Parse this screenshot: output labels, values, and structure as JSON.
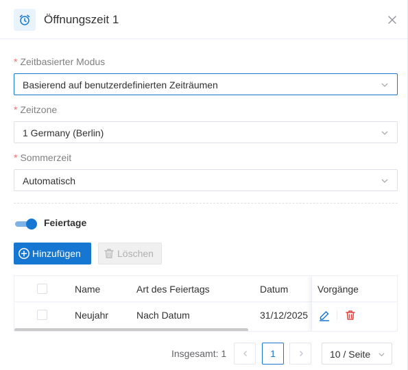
{
  "dialog": {
    "title": "Öffnungszeit 1",
    "icon": "alarm-clock-icon"
  },
  "colors": {
    "primary": "#1677d2",
    "required": "#f56c6c",
    "danger": "#e0403c"
  },
  "form": {
    "mode": {
      "label": "Zeitbasierter Modus",
      "required_mark": "*",
      "value": "Basierend auf benutzerdefinierten Zeiträumen"
    },
    "timezone": {
      "label": "Zeitzone",
      "required_mark": "*",
      "value": "1 Germany (Berlin)"
    },
    "dst": {
      "label": "Sommerzeit",
      "required_mark": "*",
      "value": "Automatisch"
    }
  },
  "holidays": {
    "toggle_label": "Feiertage",
    "toggle_on": true,
    "add_label": "Hinzufügen",
    "delete_label": "Löschen",
    "columns": [
      "Name",
      "Art des Feiertags",
      "Datum",
      "Vorgänge"
    ],
    "rows": [
      {
        "name": "Neujahr",
        "type": "Nach Datum",
        "date": "31/12/2025"
      }
    ]
  },
  "pagination": {
    "total_label": "Insgesamt: 1",
    "current_page": "1",
    "page_size": "10 / Seite"
  }
}
